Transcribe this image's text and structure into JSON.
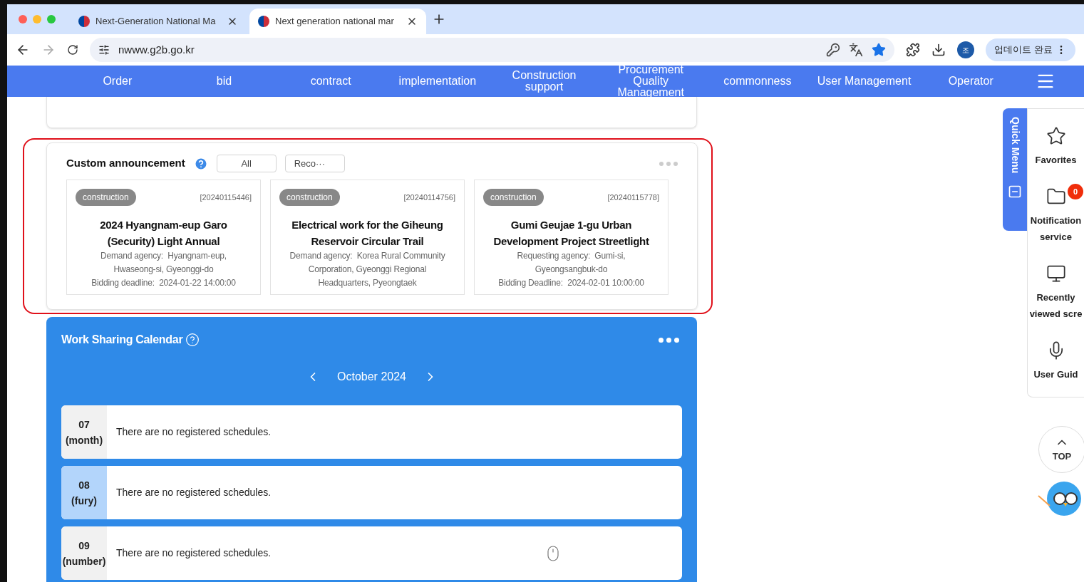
{
  "browser": {
    "tabs": [
      {
        "title": "Next-Generation National Ma",
        "selected": false
      },
      {
        "title": "Next generation national mar",
        "selected": true
      }
    ],
    "address": "nwww.g2b.go.kr",
    "profile_initial": "조",
    "update_button": "업데이트 완료"
  },
  "nav": {
    "items": [
      "Order",
      "bid",
      "contract",
      "implementation",
      "Construction support",
      "Procurement Quality Management",
      "commonness",
      "User Management",
      "Operator"
    ]
  },
  "announcements": {
    "title": "Custom announcement",
    "filters": [
      {
        "label": "All",
        "selected": false
      },
      {
        "label": "Reco···",
        "selected": false
      }
    ],
    "cards": [
      {
        "tag": "construction",
        "number": "[20240115446]",
        "title": "2024 Hyangnam-eup Garo (Security) Light Annual",
        "details": [
          "Demand agency:  Hyangnam-eup, Hwaseong-si, Gyeonggi-do",
          "Bidding deadline:  2024-01-22 14:00:00"
        ]
      },
      {
        "tag": "construction",
        "number": "[20240114756]",
        "title": "Electrical work for the Giheung Reservoir Circular Trail",
        "details": [
          "Demand agency:  Korea Rural Community Corporation, Gyeonggi Regional Headquarters, Pyeongtaek"
        ]
      },
      {
        "tag": "construction",
        "number": "[20240115778]",
        "title": "Gumi Geujae 1-gu Urban Development Project Streetlight",
        "details": [
          "Requesting agency:  Gumi-si, Gyeongsangbuk-do",
          "Bidding Deadline:  2024-02-01 10:00:00"
        ]
      }
    ]
  },
  "calendar": {
    "title": "Work Sharing Calendar",
    "month": "October 2024",
    "days": [
      {
        "date": "07",
        "weekday": "(month)",
        "text": "There are no registered schedules.",
        "selected": false
      },
      {
        "date": "08",
        "weekday": "(fury)",
        "text": "There are no registered schedules.",
        "selected": true
      },
      {
        "date": "09",
        "weekday": "(number)",
        "text": "There are no registered schedules.",
        "selected": false
      }
    ]
  },
  "quick_menu": {
    "title": "Quick Menu",
    "items": [
      {
        "kind": "favorites",
        "label": "Favorites"
      },
      {
        "kind": "notification",
        "label": "Notification service",
        "badge": "0"
      },
      {
        "kind": "recent",
        "label": "Recently viewed scre"
      },
      {
        "kind": "guide",
        "label": "User Guid"
      }
    ],
    "top_button": "TOP"
  }
}
